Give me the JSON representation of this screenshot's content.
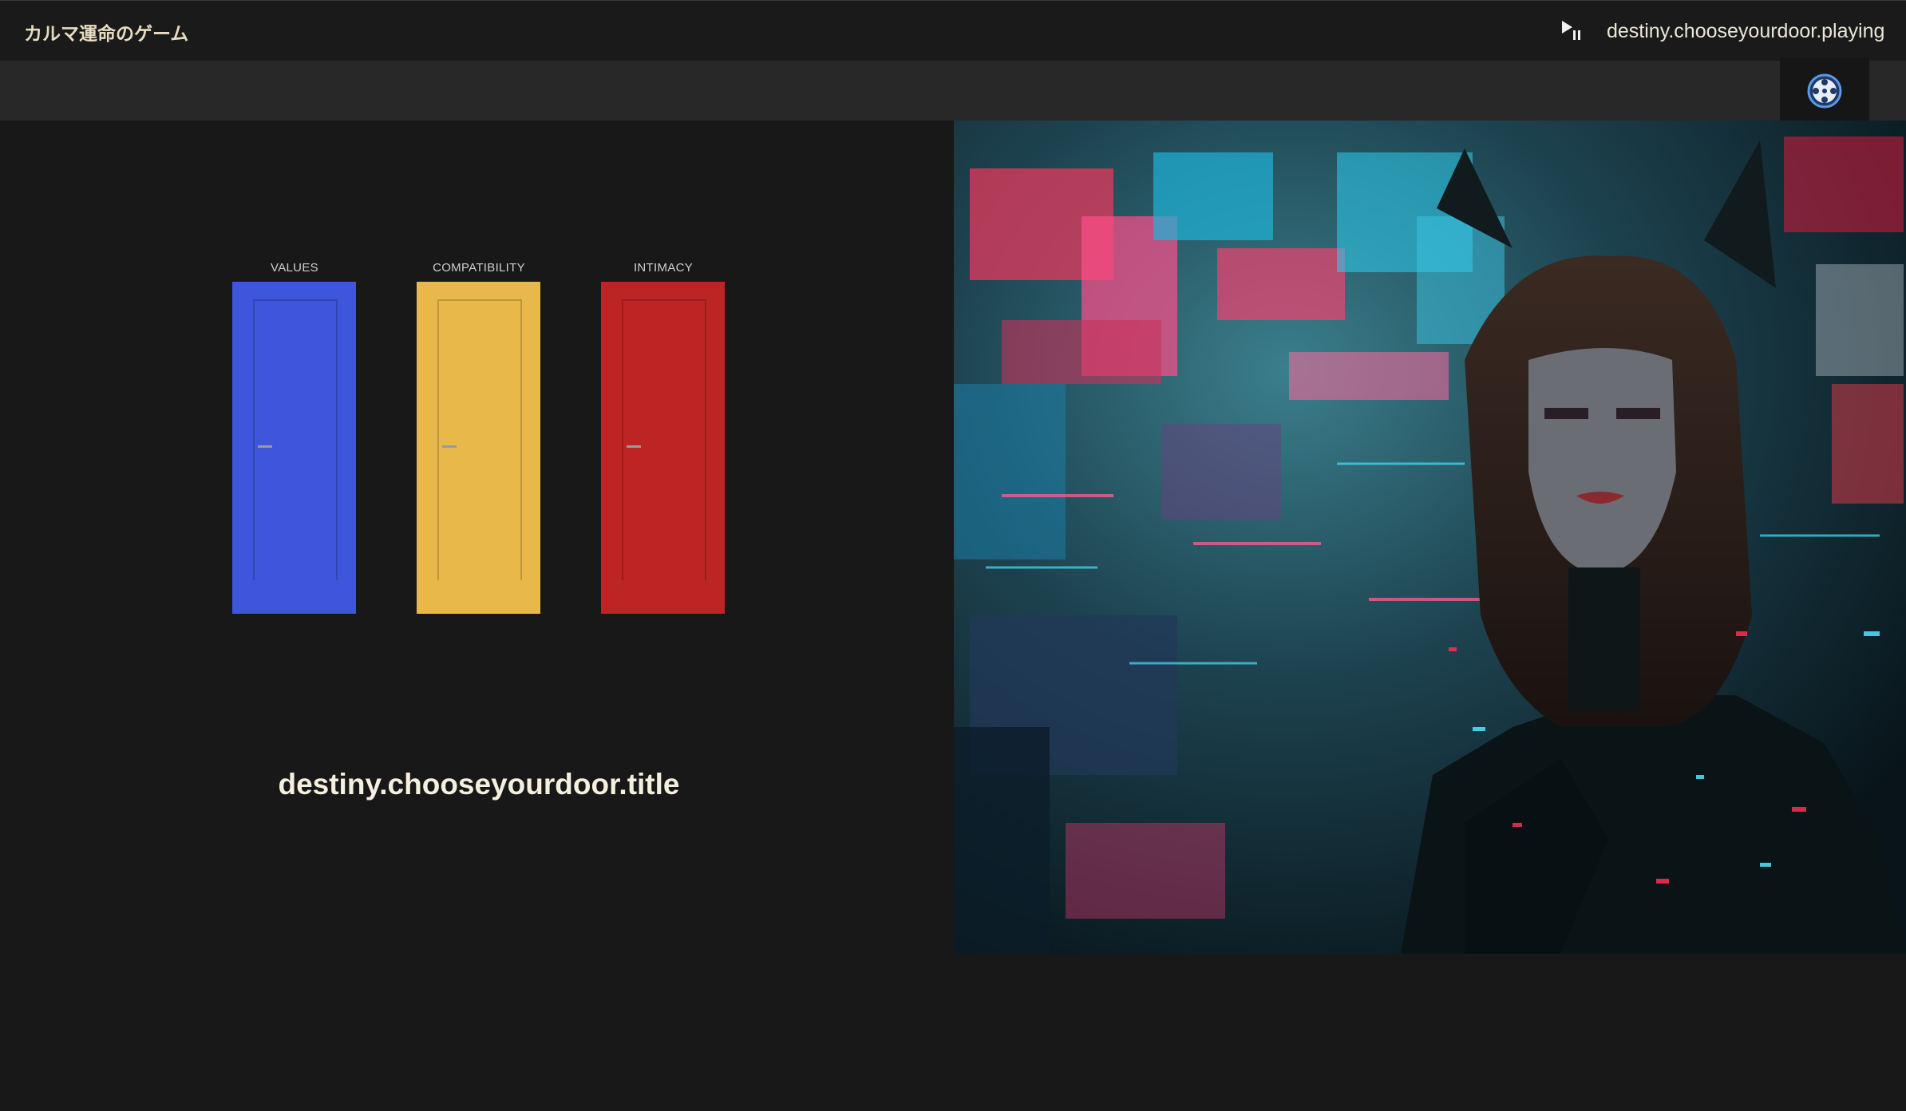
{
  "header": {
    "app_title": "カルマ運命のゲーム",
    "now_playing": "destiny.chooseyourdoor.playing"
  },
  "icons": {
    "play_pause": "play-pause-icon",
    "settings": "film-reel-icon"
  },
  "doors": [
    {
      "label": "VALUES",
      "color": "#3d56db"
    },
    {
      "label": "COMPATIBILITY",
      "color": "#e8b84a"
    },
    {
      "label": "INTIMACY",
      "color": "#bd2424"
    }
  ],
  "main": {
    "title": "destiny.chooseyourdoor.title"
  },
  "colors": {
    "background": "#181818",
    "header": "#1a1a1a",
    "subbar": "#282828",
    "accent_icon": "#3f7fd8"
  }
}
